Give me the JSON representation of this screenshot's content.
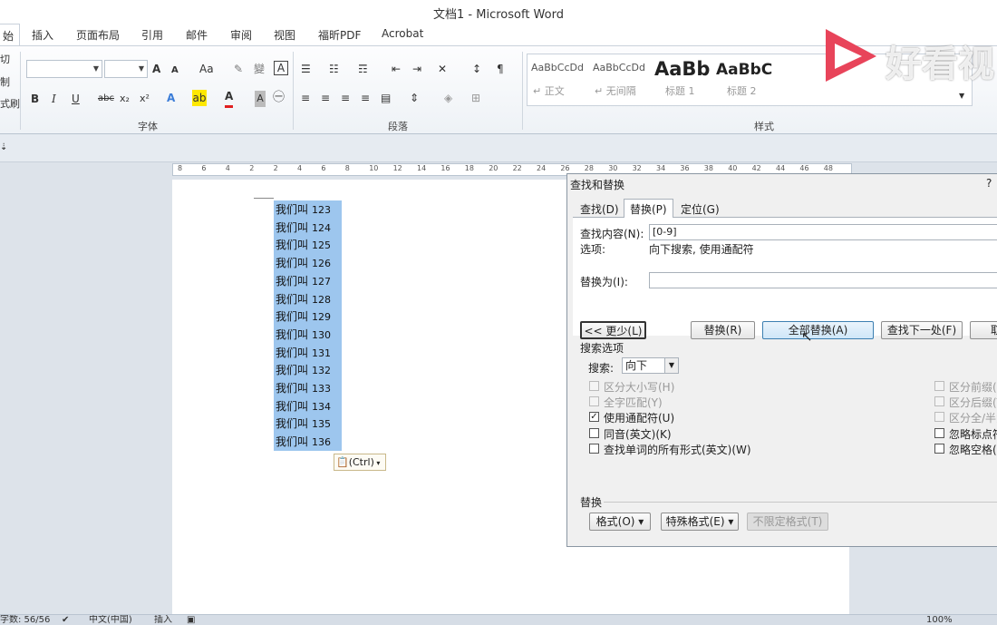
{
  "window": {
    "title": "文档1 - Microsoft Word"
  },
  "tabs": [
    {
      "label": "始",
      "active": true
    },
    {
      "label": "插入"
    },
    {
      "label": "页面布局"
    },
    {
      "label": "引用"
    },
    {
      "label": "邮件"
    },
    {
      "label": "审阅"
    },
    {
      "label": "视图"
    },
    {
      "label": "福昕PDF"
    },
    {
      "label": "Acrobat"
    }
  ],
  "ribbon": {
    "clipboard_side": [
      "切",
      "制",
      "式刷"
    ],
    "font_group_label": "字体",
    "paragraph_group_label": "段落",
    "styles_group_label": "样式",
    "font_buttons": [
      "A",
      "A",
      "Aa",
      "B",
      "I",
      "U",
      "abc",
      "x₂",
      "x²",
      "A",
      "A",
      "A"
    ],
    "styles": [
      {
        "sample": "AaBbCcDd",
        "name": "↵ 正文"
      },
      {
        "sample": "AaBbCcDd",
        "name": "↵ 无间隔"
      },
      {
        "sample": "AaBb",
        "name": "标题 1"
      },
      {
        "sample": "AaBbC",
        "name": "标题 2"
      }
    ]
  },
  "ruler": {
    "ticks": [
      "8",
      "6",
      "4",
      "2",
      "2",
      "4",
      "6",
      "8",
      "10",
      "12",
      "14",
      "16",
      "18",
      "20",
      "22",
      "24",
      "26",
      "28",
      "30",
      "32",
      "34",
      "36",
      "38",
      "40",
      "42",
      "44",
      "46",
      "48"
    ]
  },
  "document": {
    "lines": [
      {
        "text": "我们叫",
        "num": "123"
      },
      {
        "text": "我们叫",
        "num": "124"
      },
      {
        "text": "我们叫",
        "num": "125"
      },
      {
        "text": "我们叫",
        "num": "126"
      },
      {
        "text": "我们叫",
        "num": "127"
      },
      {
        "text": "我们叫",
        "num": "128"
      },
      {
        "text": "我们叫",
        "num": "129"
      },
      {
        "text": "我们叫",
        "num": "130"
      },
      {
        "text": "我们叫",
        "num": "131"
      },
      {
        "text": "我们叫",
        "num": "132"
      },
      {
        "text": "我们叫",
        "num": "133"
      },
      {
        "text": "我们叫",
        "num": "134"
      },
      {
        "text": "我们叫",
        "num": "135"
      },
      {
        "text": "我们叫",
        "num": "136"
      }
    ],
    "paste_options": "(Ctrl)"
  },
  "dialog": {
    "title": "查找和替换",
    "help": "?",
    "tabs": [
      "查找(D)",
      "替换(P)",
      "定位(G)"
    ],
    "find_label": "查找内容(N):",
    "find_value": "[0-9]",
    "options_label": "选项:",
    "options_value": "向下搜索, 使用通配符",
    "replace_label": "替换为(I):",
    "replace_value": "",
    "buttons": {
      "less": "<< 更少(L)",
      "replace": "替换(R)",
      "replace_all": "全部替换(A)",
      "find_next": "查找下一处(F)",
      "cancel": "取"
    },
    "search_options_title": "搜索选项",
    "search_label": "搜索:",
    "search_value": "向下",
    "checkboxes_left": [
      {
        "label": "区分大小写(H)",
        "checked": false,
        "disabled": true
      },
      {
        "label": "全字匹配(Y)",
        "checked": false,
        "disabled": true
      },
      {
        "label": "使用通配符(U)",
        "checked": true,
        "disabled": false
      },
      {
        "label": "同音(英文)(K)",
        "checked": false,
        "disabled": false
      },
      {
        "label": "查找单词的所有形式(英文)(W)",
        "checked": false,
        "disabled": false
      }
    ],
    "checkboxes_right": [
      {
        "label": "区分前缀(X)",
        "checked": false,
        "disabled": true
      },
      {
        "label": "区分后缀(T)",
        "checked": false,
        "disabled": true
      },
      {
        "label": "区分全/半角",
        "checked": false,
        "disabled": true
      },
      {
        "label": "忽略标点符",
        "checked": false,
        "disabled": false
      },
      {
        "label": "忽略空格(W)",
        "checked": false,
        "disabled": false
      }
    ],
    "replace_section_title": "替换",
    "format_button": "格式(O) ▾",
    "special_button": "特殊格式(E) ▾",
    "no_format_button": "不限定格式(T)"
  },
  "status": {
    "words": "字数: 56/56",
    "language": "中文(中国)",
    "mode": "插入",
    "zoom": "100%"
  },
  "watermark": {
    "text": "好看视"
  }
}
